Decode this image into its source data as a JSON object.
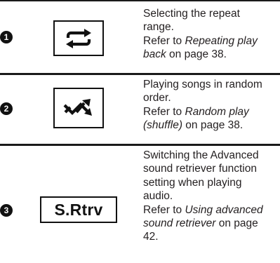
{
  "rows": [
    {
      "number": "1",
      "icon": "repeat-icon",
      "lines": [
        "Selecting the repeat",
        "range."
      ],
      "ref_prefix": "Refer to ",
      "ref_italic_line1": "Repeating play",
      "ref_italic_line2": "back",
      "ref_suffix": " on page 38."
    },
    {
      "number": "2",
      "icon": "shuffle-icon",
      "lines": [
        "Playing songs in random",
        "order."
      ],
      "ref_prefix": "Refer to ",
      "ref_italic_line1": "Random play",
      "ref_italic_line2": "(shuffle)",
      "ref_suffix": " on page 38."
    },
    {
      "number": "3",
      "icon_text": "S.Rtrv",
      "lines": [
        "Switching the Advanced",
        "sound retriever function",
        "setting when playing",
        "audio."
      ],
      "ref_prefix": "Refer to ",
      "ref_italic_line1": "Using advanced",
      "ref_italic_line2": "sound retriever",
      "ref_suffix_line2": " on page",
      "ref_suffix_line3": "42."
    }
  ]
}
